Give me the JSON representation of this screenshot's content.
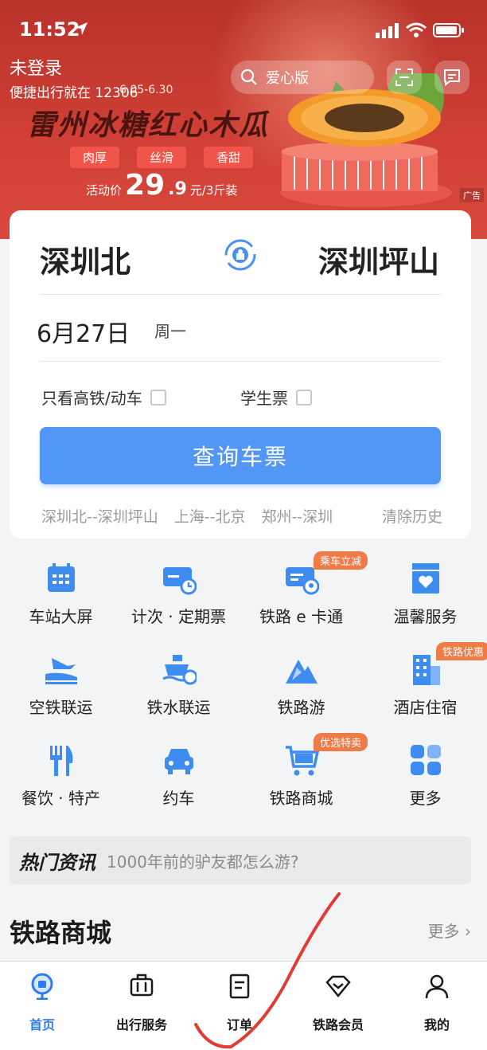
{
  "status": {
    "time": "11:52"
  },
  "header": {
    "login_text": "未登录",
    "slogan": "便捷出行就在 12306",
    "search_placeholder": "爱心版"
  },
  "banner": {
    "dates": "6.05-6.30",
    "title": "雷州冰糖红心木瓜",
    "tags": [
      "肉厚",
      "丝滑",
      "香甜"
    ],
    "price_label": "活动价",
    "price_int": "29",
    "price_dec": ".9",
    "price_unit": "元/3斤装",
    "ad_label": "广告"
  },
  "search_card": {
    "from_station": "深圳北",
    "to_station": "深圳坪山",
    "date": "6月27日",
    "weekday": "周一",
    "option_highspeed": "只看高铁/动车",
    "option_student": "学生票",
    "query_button": "查询车票",
    "history": [
      "深圳北--深圳坪山",
      "上海--北京",
      "郑州--深圳"
    ],
    "clear_history": "清除历史"
  },
  "services": [
    {
      "label": "车站大屏",
      "icon": "station-screen-icon"
    },
    {
      "label": "计次 · 定期票",
      "icon": "ticket-pass-icon"
    },
    {
      "label": "铁路 e 卡通",
      "icon": "ecard-icon",
      "badge": "乘车立减"
    },
    {
      "label": "温馨服务",
      "icon": "care-service-icon"
    },
    {
      "label": "空铁联运",
      "icon": "air-rail-icon"
    },
    {
      "label": "铁水联运",
      "icon": "rail-ship-icon"
    },
    {
      "label": "铁路游",
      "icon": "rail-tour-icon"
    },
    {
      "label": "酒店住宿",
      "icon": "hotel-icon",
      "badge": "铁路优惠"
    },
    {
      "label": "餐饮 · 特产",
      "icon": "dining-icon"
    },
    {
      "label": "约车",
      "icon": "car-icon"
    },
    {
      "label": "铁路商城",
      "icon": "shop-cart-icon",
      "badge": "优选特卖"
    },
    {
      "label": "更多",
      "icon": "more-grid-icon"
    }
  ],
  "news": {
    "label": "热门资讯",
    "headline": "1000年前的驴友都怎么游?"
  },
  "mall_section": {
    "title": "铁路商城",
    "more": "更多 ›"
  },
  "tabbar": [
    {
      "label": "首页",
      "icon": "home-rail-icon",
      "active": true
    },
    {
      "label": "出行服务",
      "icon": "luggage-icon"
    },
    {
      "label": "订单",
      "icon": "order-icon"
    },
    {
      "label": "铁路会员",
      "icon": "member-diamond-icon"
    },
    {
      "label": "我的",
      "icon": "profile-icon"
    }
  ],
  "colors": {
    "accent": "#5296f6",
    "banner_red": "#cf3f35",
    "badge": "#ef7b47",
    "active_tab": "#2d7cf6"
  }
}
